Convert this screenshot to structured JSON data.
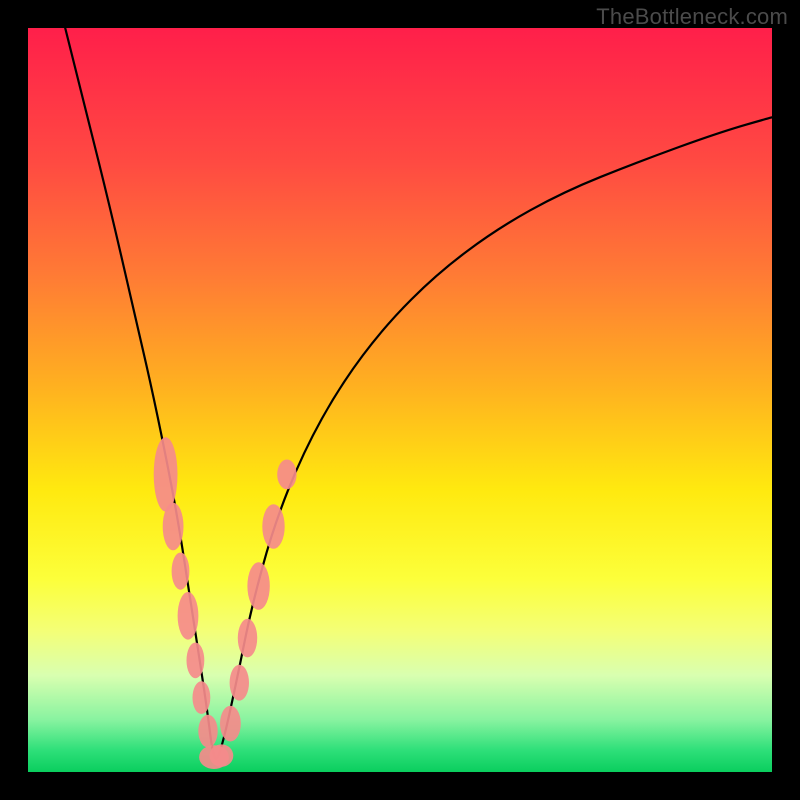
{
  "attribution": "TheBottleneck.com",
  "chart_data": {
    "type": "line",
    "title": "",
    "xlabel": "",
    "ylabel": "",
    "xlim": [
      0,
      100
    ],
    "ylim": [
      0,
      100
    ],
    "grid": false,
    "legend": false,
    "notes": "Bottleneck-style V curve on a vertical rainbow gradient. Minimum (0% bottleneck) occurs near x≈25. Salmon-colored marker clusters highlight sampled data points around the trough and lower slopes.",
    "series": [
      {
        "name": "bottleneck-curve",
        "color": "#000000",
        "x": [
          5,
          8,
          11,
          14,
          17,
          20,
          22,
          24,
          25,
          26,
          28,
          30,
          33,
          37,
          42,
          48,
          55,
          63,
          72,
          82,
          93,
          100
        ],
        "y": [
          100,
          88,
          76,
          63,
          50,
          35,
          22,
          9,
          1,
          3,
          12,
          22,
          33,
          43,
          52,
          60,
          67,
          73,
          78,
          82,
          86,
          88
        ]
      }
    ],
    "marker_clusters": [
      {
        "x": 18.5,
        "y": 40,
        "rx": 1.6,
        "ry": 5.0,
        "color": "#f58b8b"
      },
      {
        "x": 19.5,
        "y": 33,
        "rx": 1.4,
        "ry": 3.2,
        "color": "#f58b8b"
      },
      {
        "x": 20.5,
        "y": 27,
        "rx": 1.2,
        "ry": 2.5,
        "color": "#f58b8b"
      },
      {
        "x": 21.5,
        "y": 21,
        "rx": 1.4,
        "ry": 3.2,
        "color": "#f58b8b"
      },
      {
        "x": 22.5,
        "y": 15,
        "rx": 1.2,
        "ry": 2.4,
        "color": "#f58b8b"
      },
      {
        "x": 23.3,
        "y": 10,
        "rx": 1.2,
        "ry": 2.2,
        "color": "#f58b8b"
      },
      {
        "x": 24.2,
        "y": 5.5,
        "rx": 1.3,
        "ry": 2.2,
        "color": "#f58b8b"
      },
      {
        "x": 25.0,
        "y": 2.0,
        "rx": 2.0,
        "ry": 1.6,
        "color": "#f58b8b"
      },
      {
        "x": 26.0,
        "y": 2.2,
        "rx": 1.6,
        "ry": 1.5,
        "color": "#f58b8b"
      },
      {
        "x": 27.2,
        "y": 6.5,
        "rx": 1.4,
        "ry": 2.4,
        "color": "#f58b8b"
      },
      {
        "x": 28.4,
        "y": 12,
        "rx": 1.3,
        "ry": 2.4,
        "color": "#f58b8b"
      },
      {
        "x": 29.5,
        "y": 18,
        "rx": 1.3,
        "ry": 2.6,
        "color": "#f58b8b"
      },
      {
        "x": 31.0,
        "y": 25,
        "rx": 1.5,
        "ry": 3.2,
        "color": "#f58b8b"
      },
      {
        "x": 33.0,
        "y": 33,
        "rx": 1.5,
        "ry": 3.0,
        "color": "#f58b8b"
      },
      {
        "x": 34.8,
        "y": 40,
        "rx": 1.3,
        "ry": 2.0,
        "color": "#f58b8b"
      }
    ]
  }
}
